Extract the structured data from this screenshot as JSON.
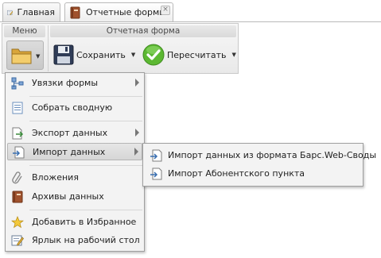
{
  "tabs": [
    {
      "label": "Главная",
      "icon": "edit-form-icon"
    },
    {
      "label": "Отчетные формы",
      "icon": "book-icon",
      "close": "×"
    }
  ],
  "ribbon": {
    "menu_group": "Меню",
    "form_group": "Отчетная форма",
    "save_label": "Сохранить",
    "recalc_label": "Пересчитать"
  },
  "menu": {
    "items": [
      {
        "label": "Увязки формы",
        "icon": "links-icon"
      },
      {
        "label": "Собрать сводную",
        "icon": "summary-icon"
      },
      {
        "label": "Экспорт данных",
        "icon": "export-icon"
      },
      {
        "label": "Импорт данных",
        "icon": "import-icon"
      },
      {
        "label": "Вложения",
        "icon": "paperclip-icon"
      },
      {
        "label": "Архивы данных",
        "icon": "archive-icon"
      },
      {
        "label": "Добавить в Избранное",
        "icon": "star-icon"
      },
      {
        "label": "Ярлык на рабочий стол",
        "icon": "shortcut-icon"
      }
    ]
  },
  "submenu": {
    "items": [
      {
        "label": "Импорт данных из формата Барс.Web-Своды",
        "icon": "import-icon"
      },
      {
        "label": "Импорт Абонентского пункта",
        "icon": "import-icon"
      }
    ]
  },
  "colors": {
    "accent_green": "#5cb832",
    "folder": "#e2b44a",
    "save": "#2f3c57"
  }
}
